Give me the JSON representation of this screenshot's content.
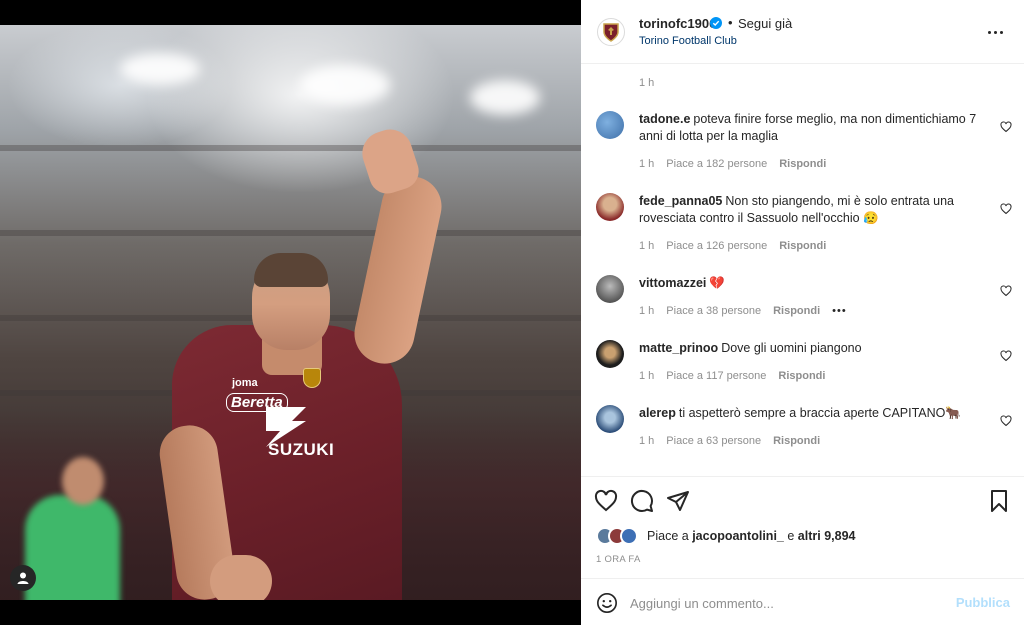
{
  "post_author": {
    "username": "torinofc1906",
    "follow_label": "Segui già",
    "subtitle": "Torino Football Club"
  },
  "image_text": {
    "joma": "joma",
    "beretta": "Beretta",
    "suzuki": "SUZUKI"
  },
  "top_time": "1 h",
  "comments": [
    {
      "user": "tadone.e",
      "text": "poteva finire forse meglio, ma non dimentichiamo 7 anni di lotta per la maglia",
      "time": "1 h",
      "likes": "Piace a 182 persone",
      "reply": "Rispondi"
    },
    {
      "user": "fede_panna05",
      "text": "Non sto piangendo, mi è solo entrata una rovesciata contro il Sassuolo nell'occhio 😥",
      "time": "1 h",
      "likes": "Piace a 126 persone",
      "reply": "Rispondi"
    },
    {
      "user": "vittomazzei",
      "text": "💔",
      "time": "1 h",
      "likes": "Piace a 38 persone",
      "reply": "Rispondi",
      "more": "•••"
    },
    {
      "user": "matte_prinoo",
      "text": "Dove gli uomini piangono",
      "time": "1 h",
      "likes": "Piace a 117 persone",
      "reply": "Rispondi"
    },
    {
      "user": "alerep",
      "text": "ti aspetterò sempre a braccia aperte CAPITANO🐂",
      "time": "1 h",
      "likes": "Piace a 63 persone",
      "reply": "Rispondi"
    }
  ],
  "likes_summary": {
    "prefix": "Piace a",
    "user": "jacopoantolini_",
    "middle": "e",
    "others": "altri 9,894"
  },
  "post_time": "1 ORA FA",
  "add_comment": {
    "placeholder": "Aggiungi un commento...",
    "publish_label": "Pubblica"
  },
  "colors": {
    "link": "#00376b",
    "verified": "#0095f6",
    "publish_disabled": "#b2dffc",
    "meta_grey": "#8e8e8e",
    "shirt": "#6b2029"
  }
}
